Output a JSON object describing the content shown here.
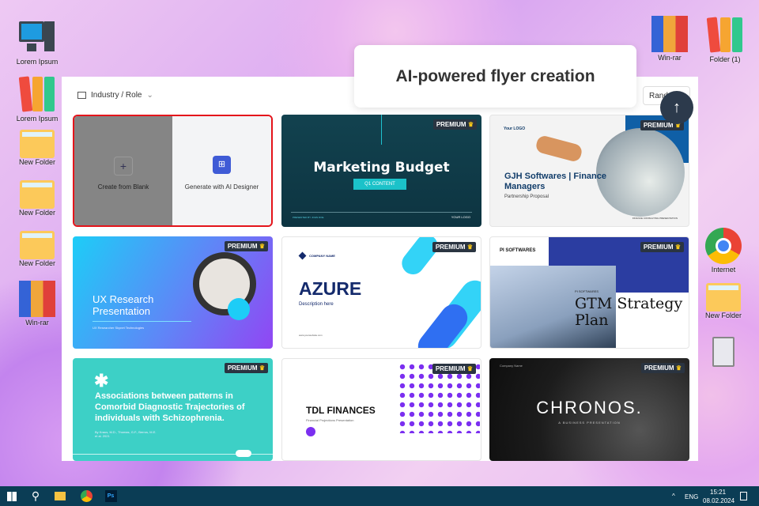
{
  "desktop": {
    "left": [
      {
        "label": "Lorem Ipsum",
        "icon": "computer-icon"
      },
      {
        "label": "Lorem Ipsum",
        "icon": "binders-icon"
      },
      {
        "label": "New Folder",
        "icon": "folder-icon"
      },
      {
        "label": "New Folder",
        "icon": "folder-icon"
      },
      {
        "label": "New Folder",
        "icon": "folder-icon"
      },
      {
        "label": "Win-rar",
        "icon": "winrar-icon"
      }
    ],
    "right": [
      {
        "label": "Win-rar",
        "icon": "winrar-icon"
      },
      {
        "label": "Folder (1)",
        "icon": "binders-icon"
      },
      {
        "label": "Internet",
        "icon": "chrome-icon"
      },
      {
        "label": "New Folder",
        "icon": "folder-icon"
      },
      {
        "label": "",
        "icon": "trash-icon"
      }
    ]
  },
  "tooltip": "AI-powered flyer creation",
  "toolbar": {
    "filter": "Industry / Role",
    "sort_value": "Rand",
    "colon": ":"
  },
  "create": {
    "blank": "Create from Blank",
    "ai": "Generate with AI Designer"
  },
  "badge": "PREMIUM",
  "templates": [
    {
      "title": "Marketing Budget",
      "sub": "Q1 CONTENT",
      "foot": "PRESENTED BY JOHN DOE",
      "logo": "YOUR LOGO"
    },
    {
      "logo": "Your LOGO",
      "title": "GJH Softwares | Finance Managers",
      "sub": "Partnership Proposal",
      "foot": "FINANCE CONSULTING PRESENTATION"
    },
    {
      "title": "UX Research Presentation",
      "sub": "UX Researcher Skynet Technologies"
    },
    {
      "company": "COMPANY NAME",
      "title": "AZURE",
      "sub": "Description here",
      "foot": "www.yourwebsite.com"
    },
    {
      "brand": "PI SOFTWARES",
      "small": "PI SOFTWARES",
      "title": "GTM Strategy Plan"
    },
    {
      "title": "Associations between patterns in Comorbid Diagnostic Trajectories of individuals with Schizophrenia.",
      "sub": "By Kraus, M.D., Thomas, G.F., Berros, M.E. et al. 2021"
    },
    {
      "title": "TDL FINANCES",
      "sub": "Financial Projections Presentation"
    },
    {
      "company": "Company Name",
      "title": "CHRONOS.",
      "sub": "A BUSINESS PRESENTATION"
    }
  ],
  "taskbar": {
    "lang": "ENG",
    "time": "15:21",
    "date": "08.02.2024"
  }
}
